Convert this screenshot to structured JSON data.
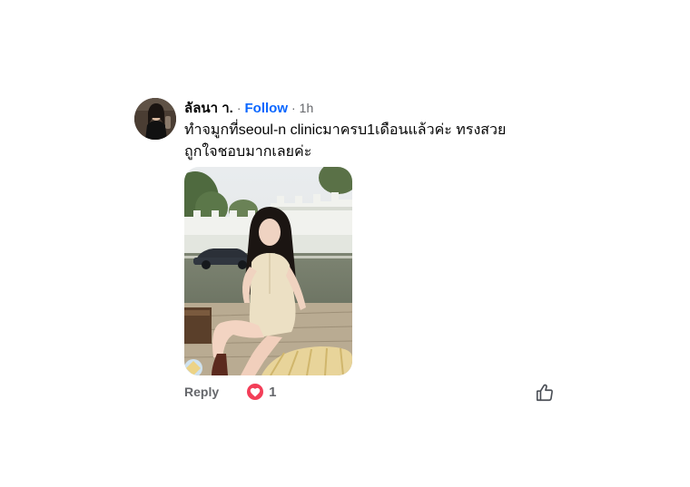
{
  "comment": {
    "author": "ลัลนา า.",
    "separator": "·",
    "follow_label": "Follow",
    "time_ago": "1h",
    "text_line_1": "ทำจมูกที่seoul-n clinicมาครบ1เดือนแล้วค่ะ ทรงสวย",
    "text_line_2": "ถูกใจชอบมากเลยค่ะ",
    "reply_label": "Reply",
    "reaction_count": "1",
    "reaction_icon": "heart-icon",
    "like_icon": "thumbs-up-icon"
  },
  "colors": {
    "follow": "#0866ff",
    "secondary_text": "#65676b",
    "heart_reaction": "#f33e58"
  }
}
